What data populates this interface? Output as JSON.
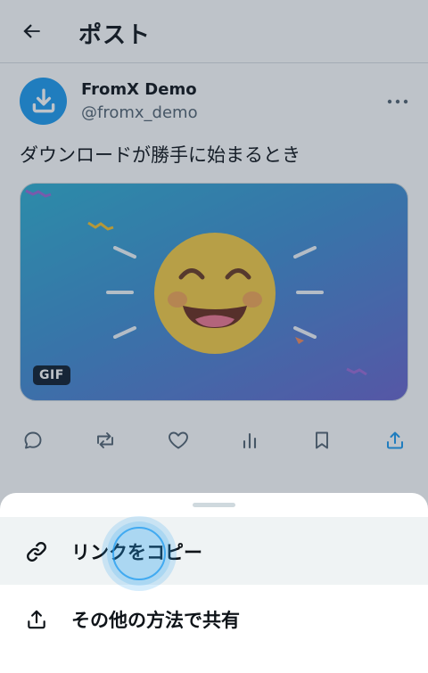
{
  "header": {
    "title": "ポスト",
    "back_icon": "arrow-left-icon"
  },
  "post": {
    "author": {
      "display_name": "FromX Demo",
      "handle": "@fromx_demo",
      "avatar_icon": "download-tray-icon",
      "avatar_color": "#1d9bf0"
    },
    "more_icon": "more-horizontal-icon",
    "text": "ダウンロードが勝手に始まるとき",
    "media": {
      "badge": "GIF",
      "content": "smiling-face-icon"
    },
    "actions": [
      {
        "name": "reply",
        "icon": "comment-icon"
      },
      {
        "name": "repost",
        "icon": "repost-icon"
      },
      {
        "name": "like",
        "icon": "heart-icon"
      },
      {
        "name": "views",
        "icon": "bar-chart-icon"
      },
      {
        "name": "bookmark",
        "icon": "bookmark-icon"
      },
      {
        "name": "share",
        "icon": "share-icon",
        "color": "#1d9bf0"
      }
    ]
  },
  "share_sheet": {
    "items": [
      {
        "label": "リンクをコピー",
        "icon": "link-icon"
      },
      {
        "label": "その他の方法で共有",
        "icon": "share-icon"
      }
    ]
  },
  "colors": {
    "accent": "#1d9bf0",
    "text": "#0f1419",
    "secondary_text": "#536471"
  }
}
